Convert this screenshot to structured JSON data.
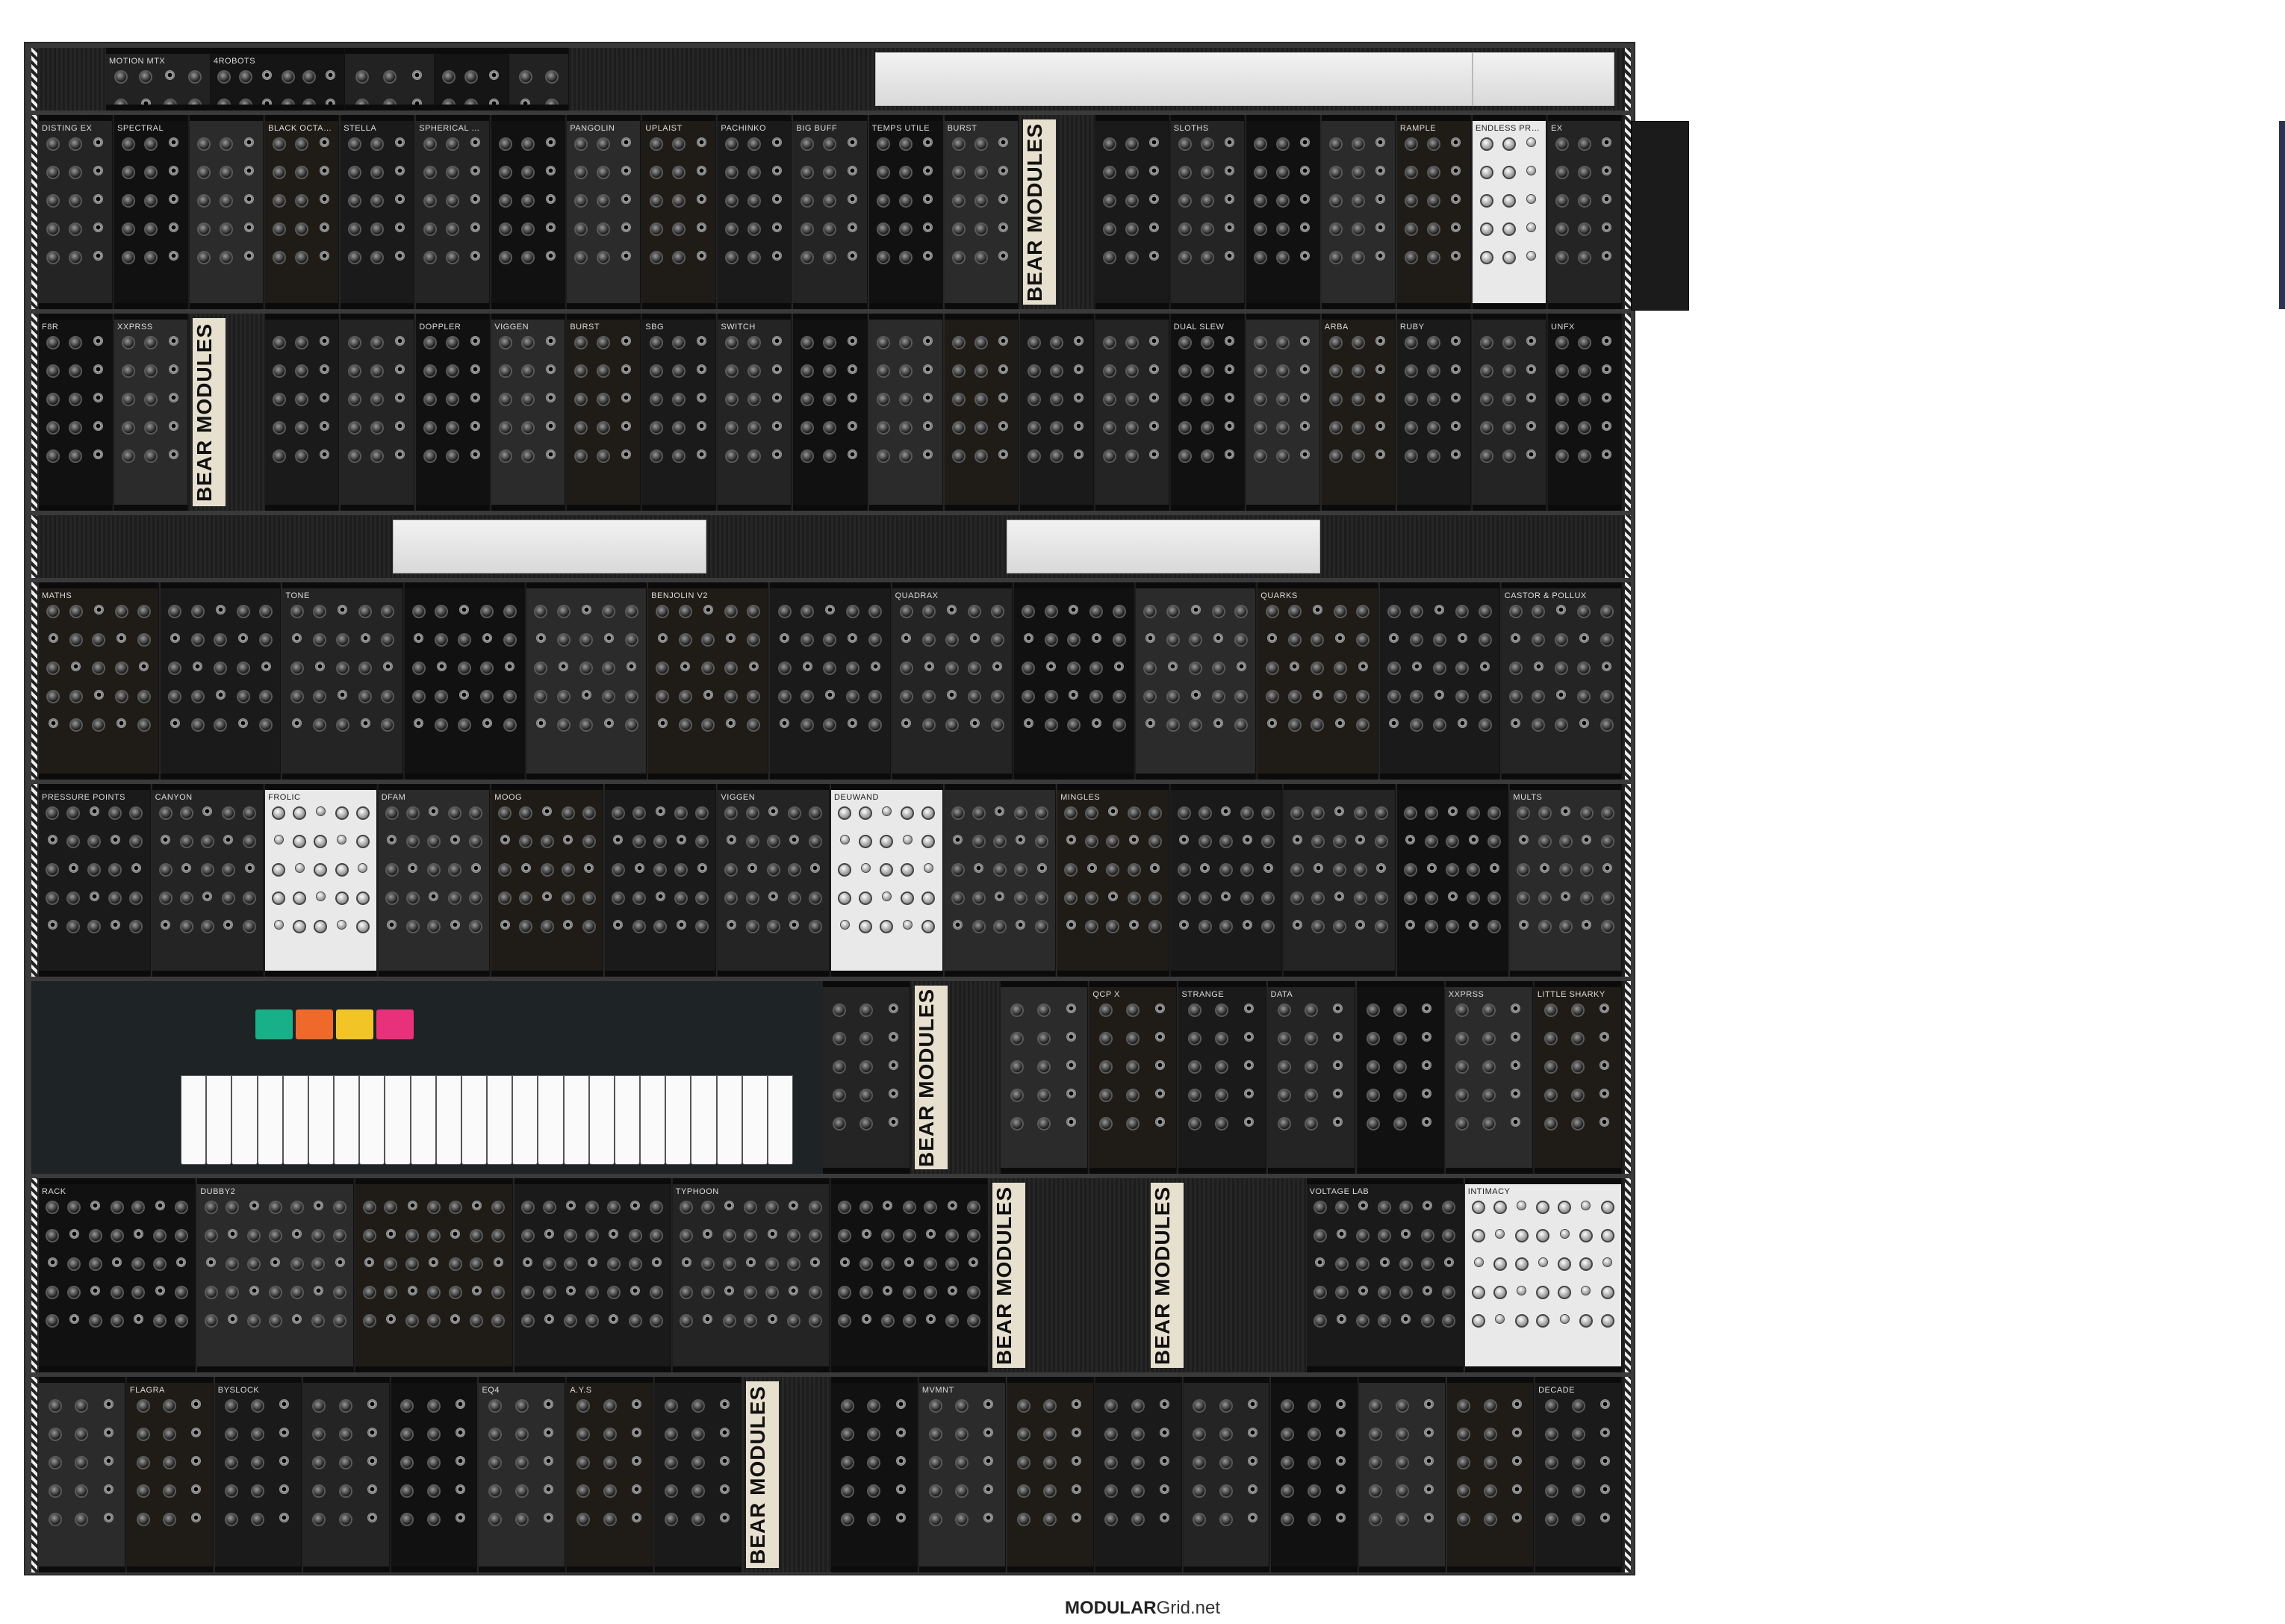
{
  "footer": {
    "brand_bold": "MODULAR",
    "brand_rest": "Grid.net"
  },
  "colors": {
    "rack": "#3a3a3a",
    "rail": "#1d1d1d",
    "blank": "#e6e6e6",
    "bear": "#e8e0cf"
  },
  "rows": [
    {
      "modules": [
        "MOTION MTX",
        "4ROBOTS",
        "",
        "",
        "",
        ""
      ]
    },
    {
      "modules": [
        "disting EX",
        "SPECTRAL",
        "",
        "BLACK OCTASOURCE",
        "STELLA",
        "SPHERICAL WAVETABLE NAVIGATOR",
        "",
        "PANGOLIN",
        "UPLAIST",
        "PACHINKO",
        "BIG BUFF",
        "TEMPS UTILE",
        "BURST",
        "BEAR MODULES",
        "",
        "SLOTHS",
        "",
        "",
        "Rample",
        "ENDLESS PROCESSOR",
        "Ex"
      ]
    },
    {
      "modules": [
        "F8R",
        "XXPRSS",
        "BEAR MODULES",
        "",
        "",
        "DOPPLER",
        "VIGGEN",
        "BURST",
        "SBG",
        "SWITCH",
        "",
        "",
        "",
        "",
        "",
        "DUAL SLEW",
        "",
        "ARBA",
        "RUBY",
        "",
        "unFx"
      ]
    },
    {
      "modules": []
    },
    {
      "modules": [
        "MATHS",
        "",
        "Tone",
        "",
        "",
        "BENJOLIN V2",
        "",
        "QUADRAX",
        "",
        "",
        "QUARKS",
        "",
        "Castor & Pollux"
      ]
    },
    {
      "modules": [
        "PRESSURE POINTS",
        "CANYON",
        "FROLIC",
        "DFAM",
        "moog",
        "",
        "VIGGEN",
        "Deuwand",
        "",
        "MINGLES",
        "",
        "",
        "",
        "Mults"
      ]
    },
    {
      "modules": [
        "",
        "BEAR MODULES",
        "",
        "QCP X",
        "Strange",
        "DATA",
        "",
        "XXPRSS",
        "LITTLE SHARKY"
      ]
    },
    {
      "modules": [
        "RACK",
        "DUBBY2",
        "",
        "",
        "TYPHOON",
        "",
        "BEAR MODULES",
        "BEAR MODULES",
        "Voltage Lab",
        "INTIMACY"
      ]
    },
    {
      "modules": [
        "",
        "FLAGRA",
        "BYSLOCK",
        "",
        "",
        "EQ4",
        "A.Y.S",
        "",
        "BEAR MODULES",
        "",
        "MVMNT",
        "",
        "",
        "",
        "",
        "",
        "",
        "DECADE"
      ]
    }
  ]
}
